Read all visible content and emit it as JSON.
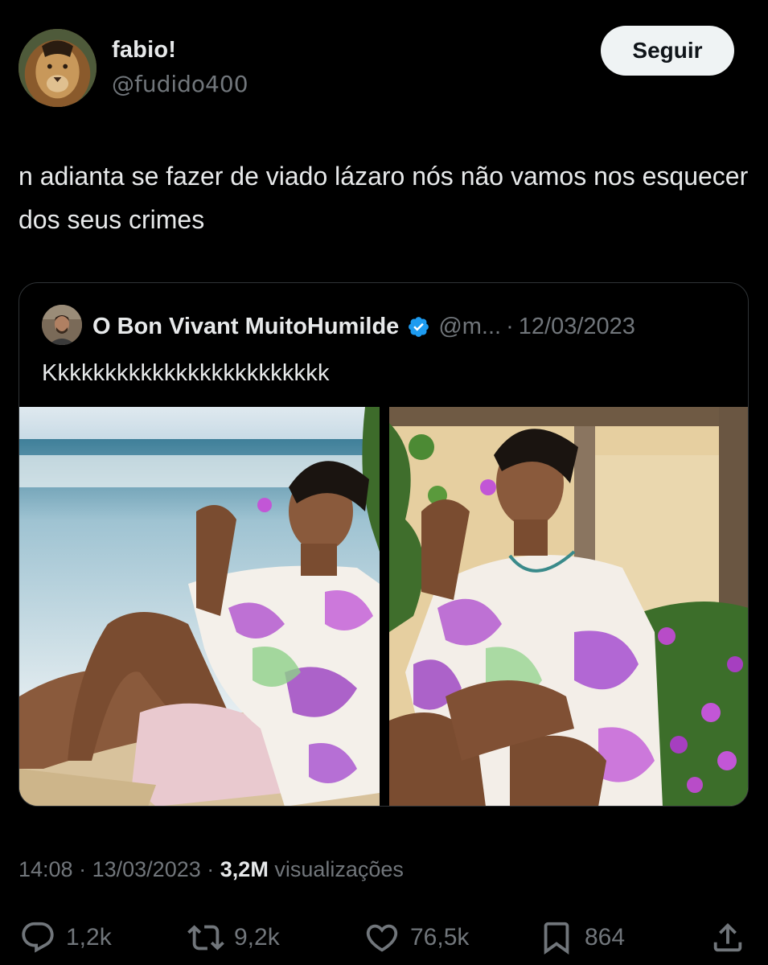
{
  "author": {
    "name": "fabio!",
    "handle": "@fudido400",
    "avatar_icon": "lion-face-avatar"
  },
  "follow_button": {
    "label": "Seguir"
  },
  "tweet": {
    "text": "n adianta se fazer de viado lázaro nós não vamos nos esquecer dos seus crimes"
  },
  "quote": {
    "name": "O Bon Vivant MuitoHumilde",
    "verified": true,
    "verified_color": "#1d9bf0",
    "handle": "@m...",
    "separator": "·",
    "date": "12/03/2023",
    "text": "Kkkkkkkkkkkkkkkkkkkkkkkk",
    "images": [
      "beach-portrait-photo",
      "garden-portrait-photo"
    ]
  },
  "meta": {
    "time": "14:08",
    "separator": "·",
    "date": "13/03/2023",
    "views_count": "3,2M",
    "views_label": "visualizações"
  },
  "actions": {
    "reply_count": "1,2k",
    "retweet_count": "9,2k",
    "like_count": "76,5k",
    "bookmark_count": "864"
  },
  "colors": {
    "background": "#000000",
    "text_primary": "#e7e9ea",
    "text_secondary": "#71767b",
    "border": "#2f3336",
    "follow_bg": "#eff3f4"
  }
}
